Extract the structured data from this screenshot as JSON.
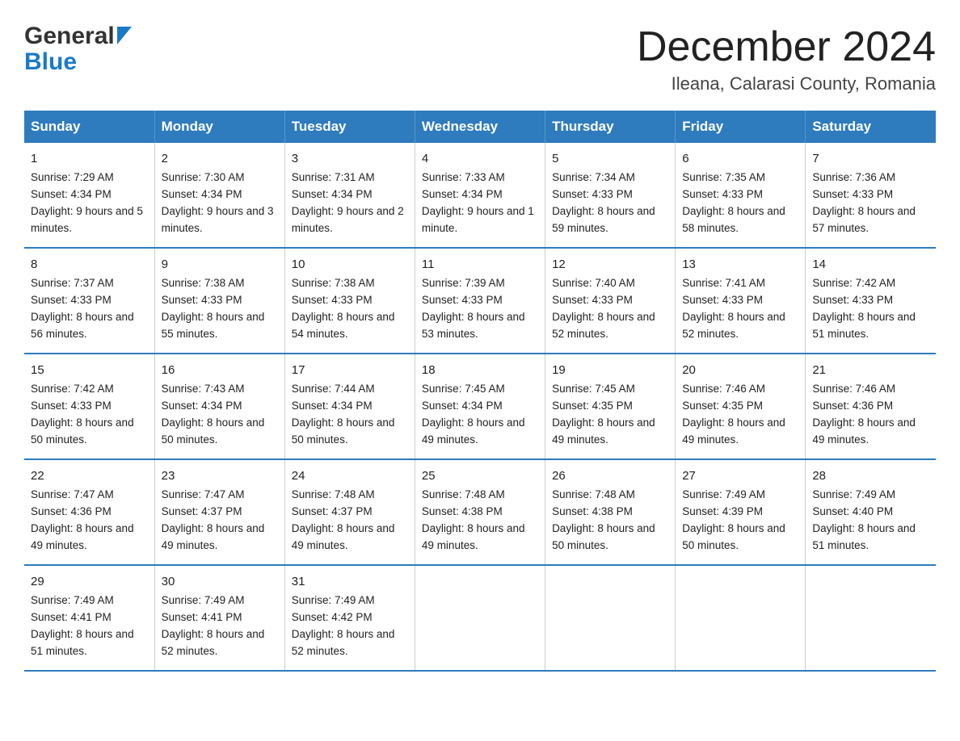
{
  "header": {
    "title": "December 2024",
    "subtitle": "Ileana, Calarasi County, Romania",
    "logo_general": "General",
    "logo_blue": "Blue"
  },
  "days_of_week": [
    "Sunday",
    "Monday",
    "Tuesday",
    "Wednesday",
    "Thursday",
    "Friday",
    "Saturday"
  ],
  "weeks": [
    [
      {
        "day": "1",
        "sunrise": "7:29 AM",
        "sunset": "4:34 PM",
        "daylight": "9 hours and 5 minutes."
      },
      {
        "day": "2",
        "sunrise": "7:30 AM",
        "sunset": "4:34 PM",
        "daylight": "9 hours and 3 minutes."
      },
      {
        "day": "3",
        "sunrise": "7:31 AM",
        "sunset": "4:34 PM",
        "daylight": "9 hours and 2 minutes."
      },
      {
        "day": "4",
        "sunrise": "7:33 AM",
        "sunset": "4:34 PM",
        "daylight": "9 hours and 1 minute."
      },
      {
        "day": "5",
        "sunrise": "7:34 AM",
        "sunset": "4:33 PM",
        "daylight": "8 hours and 59 minutes."
      },
      {
        "day": "6",
        "sunrise": "7:35 AM",
        "sunset": "4:33 PM",
        "daylight": "8 hours and 58 minutes."
      },
      {
        "day": "7",
        "sunrise": "7:36 AM",
        "sunset": "4:33 PM",
        "daylight": "8 hours and 57 minutes."
      }
    ],
    [
      {
        "day": "8",
        "sunrise": "7:37 AM",
        "sunset": "4:33 PM",
        "daylight": "8 hours and 56 minutes."
      },
      {
        "day": "9",
        "sunrise": "7:38 AM",
        "sunset": "4:33 PM",
        "daylight": "8 hours and 55 minutes."
      },
      {
        "day": "10",
        "sunrise": "7:38 AM",
        "sunset": "4:33 PM",
        "daylight": "8 hours and 54 minutes."
      },
      {
        "day": "11",
        "sunrise": "7:39 AM",
        "sunset": "4:33 PM",
        "daylight": "8 hours and 53 minutes."
      },
      {
        "day": "12",
        "sunrise": "7:40 AM",
        "sunset": "4:33 PM",
        "daylight": "8 hours and 52 minutes."
      },
      {
        "day": "13",
        "sunrise": "7:41 AM",
        "sunset": "4:33 PM",
        "daylight": "8 hours and 52 minutes."
      },
      {
        "day": "14",
        "sunrise": "7:42 AM",
        "sunset": "4:33 PM",
        "daylight": "8 hours and 51 minutes."
      }
    ],
    [
      {
        "day": "15",
        "sunrise": "7:42 AM",
        "sunset": "4:33 PM",
        "daylight": "8 hours and 50 minutes."
      },
      {
        "day": "16",
        "sunrise": "7:43 AM",
        "sunset": "4:34 PM",
        "daylight": "8 hours and 50 minutes."
      },
      {
        "day": "17",
        "sunrise": "7:44 AM",
        "sunset": "4:34 PM",
        "daylight": "8 hours and 50 minutes."
      },
      {
        "day": "18",
        "sunrise": "7:45 AM",
        "sunset": "4:34 PM",
        "daylight": "8 hours and 49 minutes."
      },
      {
        "day": "19",
        "sunrise": "7:45 AM",
        "sunset": "4:35 PM",
        "daylight": "8 hours and 49 minutes."
      },
      {
        "day": "20",
        "sunrise": "7:46 AM",
        "sunset": "4:35 PM",
        "daylight": "8 hours and 49 minutes."
      },
      {
        "day": "21",
        "sunrise": "7:46 AM",
        "sunset": "4:36 PM",
        "daylight": "8 hours and 49 minutes."
      }
    ],
    [
      {
        "day": "22",
        "sunrise": "7:47 AM",
        "sunset": "4:36 PM",
        "daylight": "8 hours and 49 minutes."
      },
      {
        "day": "23",
        "sunrise": "7:47 AM",
        "sunset": "4:37 PM",
        "daylight": "8 hours and 49 minutes."
      },
      {
        "day": "24",
        "sunrise": "7:48 AM",
        "sunset": "4:37 PM",
        "daylight": "8 hours and 49 minutes."
      },
      {
        "day": "25",
        "sunrise": "7:48 AM",
        "sunset": "4:38 PM",
        "daylight": "8 hours and 49 minutes."
      },
      {
        "day": "26",
        "sunrise": "7:48 AM",
        "sunset": "4:38 PM",
        "daylight": "8 hours and 50 minutes."
      },
      {
        "day": "27",
        "sunrise": "7:49 AM",
        "sunset": "4:39 PM",
        "daylight": "8 hours and 50 minutes."
      },
      {
        "day": "28",
        "sunrise": "7:49 AM",
        "sunset": "4:40 PM",
        "daylight": "8 hours and 51 minutes."
      }
    ],
    [
      {
        "day": "29",
        "sunrise": "7:49 AM",
        "sunset": "4:41 PM",
        "daylight": "8 hours and 51 minutes."
      },
      {
        "day": "30",
        "sunrise": "7:49 AM",
        "sunset": "4:41 PM",
        "daylight": "8 hours and 52 minutes."
      },
      {
        "day": "31",
        "sunrise": "7:49 AM",
        "sunset": "4:42 PM",
        "daylight": "8 hours and 52 minutes."
      },
      null,
      null,
      null,
      null
    ]
  ],
  "labels": {
    "sunrise": "Sunrise:",
    "sunset": "Sunset:",
    "daylight": "Daylight:"
  },
  "colors": {
    "header_bg": "#2e7bbe",
    "header_text": "#ffffff",
    "border_accent": "#2e7bbe"
  }
}
